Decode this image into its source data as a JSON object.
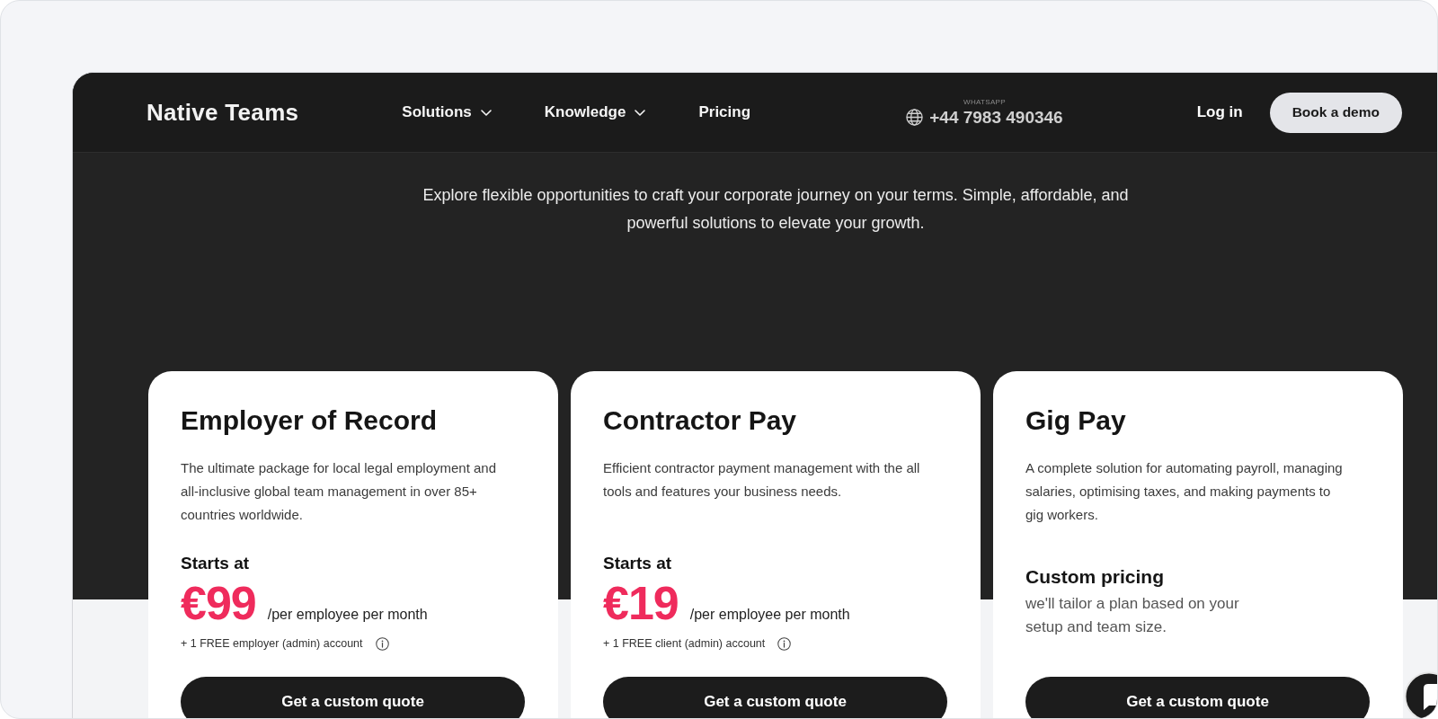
{
  "header": {
    "logo": "Native Teams",
    "nav": [
      {
        "label": "Solutions",
        "dropdown": true
      },
      {
        "label": "Knowledge",
        "dropdown": true
      },
      {
        "label": "Pricing",
        "dropdown": false
      }
    ],
    "contact": {
      "caption": "WHATSAPP",
      "phone": "+44 7983 490346"
    },
    "login": "Log in",
    "cta": "Book a demo"
  },
  "hero": {
    "intro": "Explore flexible opportunities to craft your corporate journey on your terms. Simple, affordable, and powerful solutions to elevate your growth."
  },
  "plans": [
    {
      "kind": "priced",
      "title": "Employer of Record",
      "description": "The ultimate package for local legal employment and all-inclusive global team management in over 85+ countries worldwide.",
      "price_label": "Starts at",
      "price": "€99",
      "unit": "/per employee per month",
      "note": "+ 1 FREE employer (admin) account",
      "button": "Get a custom quote"
    },
    {
      "kind": "priced",
      "title": "Contractor Pay",
      "description": "Efficient contractor payment management with the all tools and features your business needs.",
      "price_label": "Starts at",
      "price": "€19",
      "unit": "/per employee per month",
      "note": "+ 1 FREE client (admin) account",
      "button": "Get a custom quote"
    },
    {
      "kind": "custom",
      "title": "Gig Pay",
      "description": "A complete solution for automating payroll, managing salaries, optimising taxes, and making payments to gig workers.",
      "price_label": "Custom pricing",
      "price_text": "we'll tailor a plan based on your setup and team size.",
      "button": "Get a custom quote"
    }
  ]
}
